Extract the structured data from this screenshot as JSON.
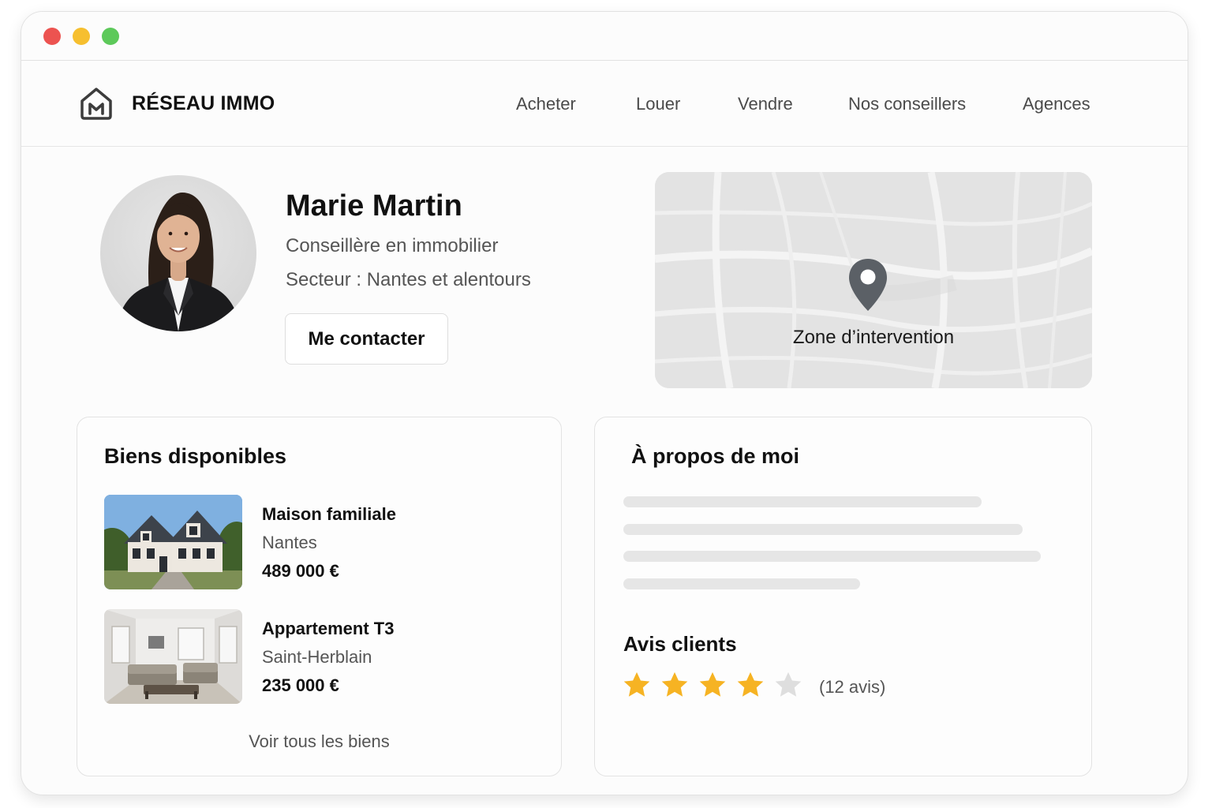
{
  "brand": {
    "name": "RÉSEAU IMMO",
    "logo_icon": "house-m-logo-icon"
  },
  "nav": {
    "links": [
      {
        "label": "Acheter"
      },
      {
        "label": "Louer"
      },
      {
        "label": "Vendre"
      },
      {
        "label": "Nos conseillers"
      },
      {
        "label": "Agences"
      }
    ]
  },
  "agent": {
    "name": "Marie Martin",
    "role": "Conseillère en immobilier",
    "sector": "Secteur : Nantes et alentours",
    "contact_label": "Me contacter"
  },
  "map": {
    "label": "Zone d’intervention",
    "pin_icon": "map-pin-icon"
  },
  "listings": {
    "title": "Biens disponibles",
    "items": [
      {
        "title": "Maison familiale",
        "city": "Nantes",
        "price": "489 000 €"
      },
      {
        "title": "Appartement T3",
        "city": "Saint-Herblain",
        "price": "235 000 €"
      }
    ],
    "see_all": "Voir tous les biens"
  },
  "about": {
    "title": "À propos de moi",
    "reviews_title": "Avis clients",
    "rating": 4,
    "rating_max": 5,
    "reviews_count": "(12 avis)"
  },
  "colors": {
    "star_filled": "#f6b323",
    "star_empty": "#dedede",
    "dot_red": "#ec5350",
    "dot_yellow": "#f6bf2f",
    "dot_green": "#5dc95a",
    "pin": "#5b6066"
  }
}
